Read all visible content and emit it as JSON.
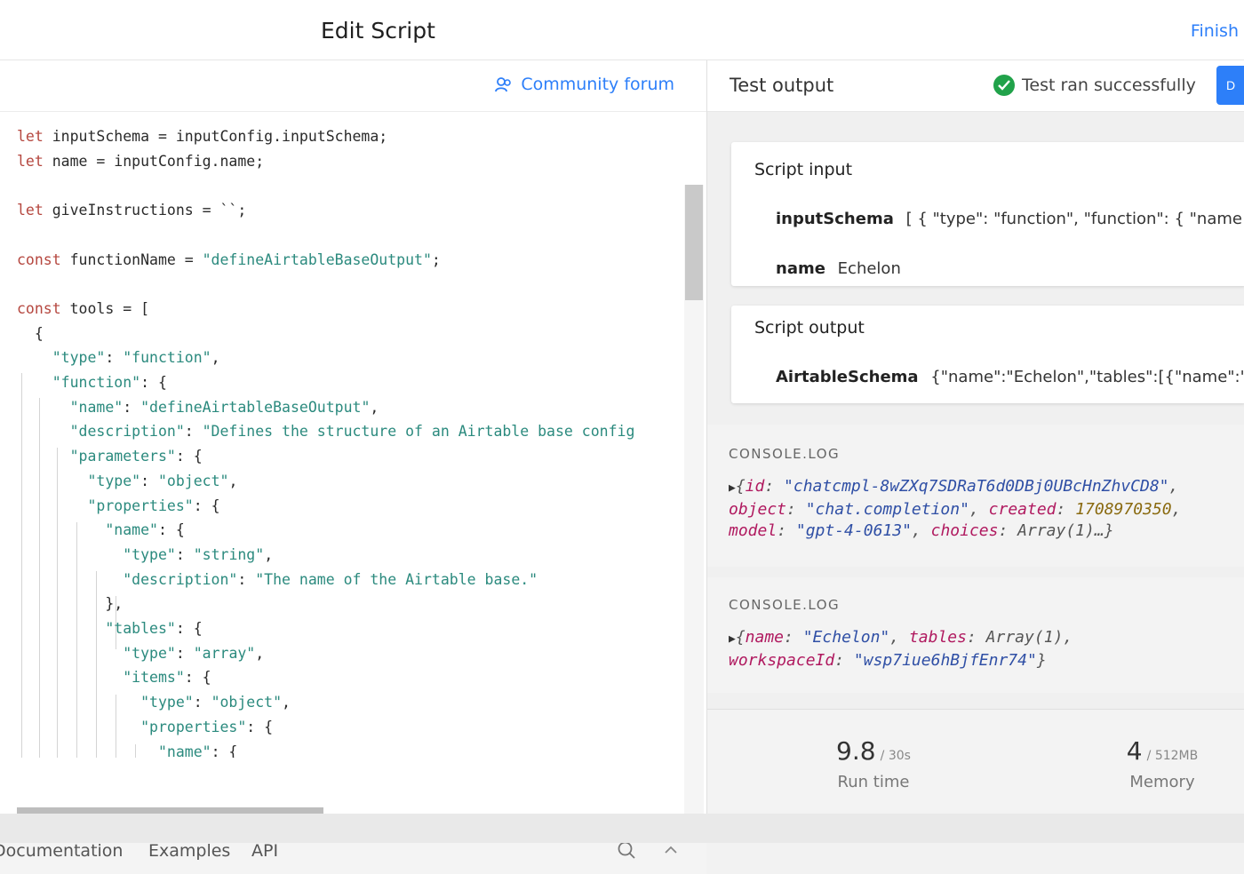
{
  "header": {
    "title": "Edit Script",
    "finish_label": "Finish"
  },
  "editor": {
    "forum_label": "Community forum",
    "lines": [
      [
        {
          "t": "let",
          "c": "k"
        },
        {
          "t": " inputSchema = inputConfig.inputSchema;"
        }
      ],
      [
        {
          "t": "let",
          "c": "k"
        },
        {
          "t": " name = inputConfig.name;"
        }
      ],
      [],
      [
        {
          "t": "let",
          "c": "k"
        },
        {
          "t": " giveInstructions = ``;"
        }
      ],
      [],
      [
        {
          "t": "const",
          "c": "k"
        },
        {
          "t": " functionName = "
        },
        {
          "t": "\"defineAirtableBaseOutput\"",
          "c": "s"
        },
        {
          "t": ";"
        }
      ],
      [],
      [
        {
          "t": "const",
          "c": "k"
        },
        {
          "t": " tools = ["
        }
      ],
      [
        {
          "t": "  {"
        }
      ],
      [
        {
          "t": "    "
        },
        {
          "t": "\"type\"",
          "c": "s"
        },
        {
          "t": ": "
        },
        {
          "t": "\"function\"",
          "c": "s"
        },
        {
          "t": ","
        }
      ],
      [
        {
          "t": "    "
        },
        {
          "t": "\"function\"",
          "c": "s"
        },
        {
          "t": ": {"
        }
      ],
      [
        {
          "t": "      "
        },
        {
          "t": "\"name\"",
          "c": "s"
        },
        {
          "t": ": "
        },
        {
          "t": "\"defineAirtableBaseOutput\"",
          "c": "s"
        },
        {
          "t": ","
        }
      ],
      [
        {
          "t": "      "
        },
        {
          "t": "\"description\"",
          "c": "s"
        },
        {
          "t": ": "
        },
        {
          "t": "\"Defines the structure of an Airtable base config",
          "c": "s"
        }
      ],
      [
        {
          "t": "      "
        },
        {
          "t": "\"parameters\"",
          "c": "s"
        },
        {
          "t": ": {"
        }
      ],
      [
        {
          "t": "        "
        },
        {
          "t": "\"type\"",
          "c": "s"
        },
        {
          "t": ": "
        },
        {
          "t": "\"object\"",
          "c": "s"
        },
        {
          "t": ","
        }
      ],
      [
        {
          "t": "        "
        },
        {
          "t": "\"properties\"",
          "c": "s"
        },
        {
          "t": ": {"
        }
      ],
      [
        {
          "t": "          "
        },
        {
          "t": "\"name\"",
          "c": "s"
        },
        {
          "t": ": {"
        }
      ],
      [
        {
          "t": "            "
        },
        {
          "t": "\"type\"",
          "c": "s"
        },
        {
          "t": ": "
        },
        {
          "t": "\"string\"",
          "c": "s"
        },
        {
          "t": ","
        }
      ],
      [
        {
          "t": "            "
        },
        {
          "t": "\"description\"",
          "c": "s"
        },
        {
          "t": ": "
        },
        {
          "t": "\"The name of the Airtable base.\"",
          "c": "s"
        }
      ],
      [
        {
          "t": "          },"
        }
      ],
      [
        {
          "t": "          "
        },
        {
          "t": "\"tables\"",
          "c": "s"
        },
        {
          "t": ": {"
        }
      ],
      [
        {
          "t": "            "
        },
        {
          "t": "\"type\"",
          "c": "s"
        },
        {
          "t": ": "
        },
        {
          "t": "\"array\"",
          "c": "s"
        },
        {
          "t": ","
        }
      ],
      [
        {
          "t": "            "
        },
        {
          "t": "\"items\"",
          "c": "s"
        },
        {
          "t": ": {"
        }
      ],
      [
        {
          "t": "              "
        },
        {
          "t": "\"type\"",
          "c": "s"
        },
        {
          "t": ": "
        },
        {
          "t": "\"object\"",
          "c": "s"
        },
        {
          "t": ","
        }
      ],
      [
        {
          "t": "              "
        },
        {
          "t": "\"properties\"",
          "c": "s"
        },
        {
          "t": ": {"
        }
      ],
      [
        {
          "t": "                "
        },
        {
          "t": "\"name\"",
          "c": "s"
        },
        {
          "t": ": {"
        }
      ]
    ]
  },
  "footer": {
    "tab_docs": "Documentation",
    "tab_examples": "Examples",
    "tab_api": "API"
  },
  "output": {
    "title": "Test output",
    "status": "Test ran successfully",
    "run_label": "D",
    "script_input": {
      "title": "Script input",
      "input_schema_key": "inputSchema",
      "input_schema_value": "[ { \"type\": \"function\", \"function\": { \"name",
      "name_key": "name",
      "name_value": "Echelon"
    },
    "script_output": {
      "title": "Script output",
      "key": "AirtableSchema",
      "value": "{\"name\":\"Echelon\",\"tables\":[{\"name\":\""
    },
    "console_1": {
      "label": "CONSOLE.LOG",
      "id_key": "id",
      "id_val": "\"chatcmpl-8wZXq7SDRaT6d0DBj0UBcHnZhvCD8\"",
      "object_key": "object",
      "object_val": "\"chat.completion\"",
      "created_key": "created",
      "created_val": "1708970350",
      "model_key": "model",
      "model_val": "\"gpt-4-0613\"",
      "choices_key": "choices",
      "choices_val": "Array(1)…"
    },
    "console_2": {
      "label": "CONSOLE.LOG",
      "name_key": "name",
      "name_val": "\"Echelon\"",
      "tables_key": "tables",
      "tables_val": "Array(1)",
      "ws_key": "workspaceId",
      "ws_val": "\"wsp7iue6hBjfEnr74\""
    },
    "stats": {
      "run_value": "9.8",
      "run_unit": "/ 30s",
      "run_label": "Run time",
      "mem_value": "4",
      "mem_unit": "/ 512MB",
      "mem_label": "Memory"
    }
  }
}
